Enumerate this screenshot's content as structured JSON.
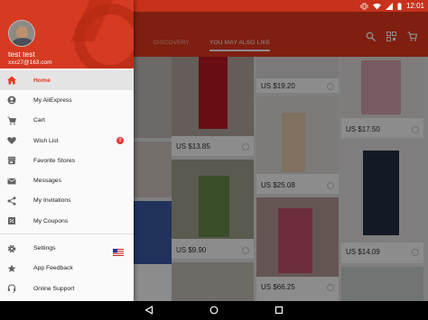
{
  "status": {
    "time": "12:01"
  },
  "tabs": [
    {
      "label": "DISCOVERY",
      "active": false
    },
    {
      "label": "YOU MAY ALSO LIKE",
      "active": true
    }
  ],
  "user": {
    "name": "test test",
    "email": "xxx27@163.com"
  },
  "menu": [
    {
      "label": "Home",
      "icon": "home-icon",
      "active": true
    },
    {
      "label": "My AliExpress",
      "icon": "account-icon"
    },
    {
      "label": "Cart",
      "icon": "cart-icon"
    },
    {
      "label": "Wish List",
      "icon": "heart-icon",
      "badge": "0"
    },
    {
      "label": "Favorite Stores",
      "icon": "store-icon"
    },
    {
      "label": "Messages",
      "icon": "mail-icon"
    },
    {
      "label": "My Invitations",
      "icon": "share-icon"
    },
    {
      "label": "My Coupons",
      "icon": "coupon-icon"
    }
  ],
  "menu2": [
    {
      "label": "Settings",
      "icon": "gear-icon",
      "flag": "us-flag-icon"
    },
    {
      "label": "App Feedback",
      "icon": "star-icon"
    },
    {
      "label": "Online Support",
      "icon": "headset-icon"
    }
  ],
  "products": [
    {
      "price": "US $19.20"
    },
    {
      "price": "US $17.50"
    },
    {
      "price": "US $13.85"
    },
    {
      "price": "US $25.08"
    },
    {
      "price": "US $9.90"
    },
    {
      "price": "US $14.09"
    },
    {
      "price": "US $66.25"
    }
  ],
  "colors": {
    "brand": "#e8391e",
    "status_bar": "#c8311c"
  }
}
